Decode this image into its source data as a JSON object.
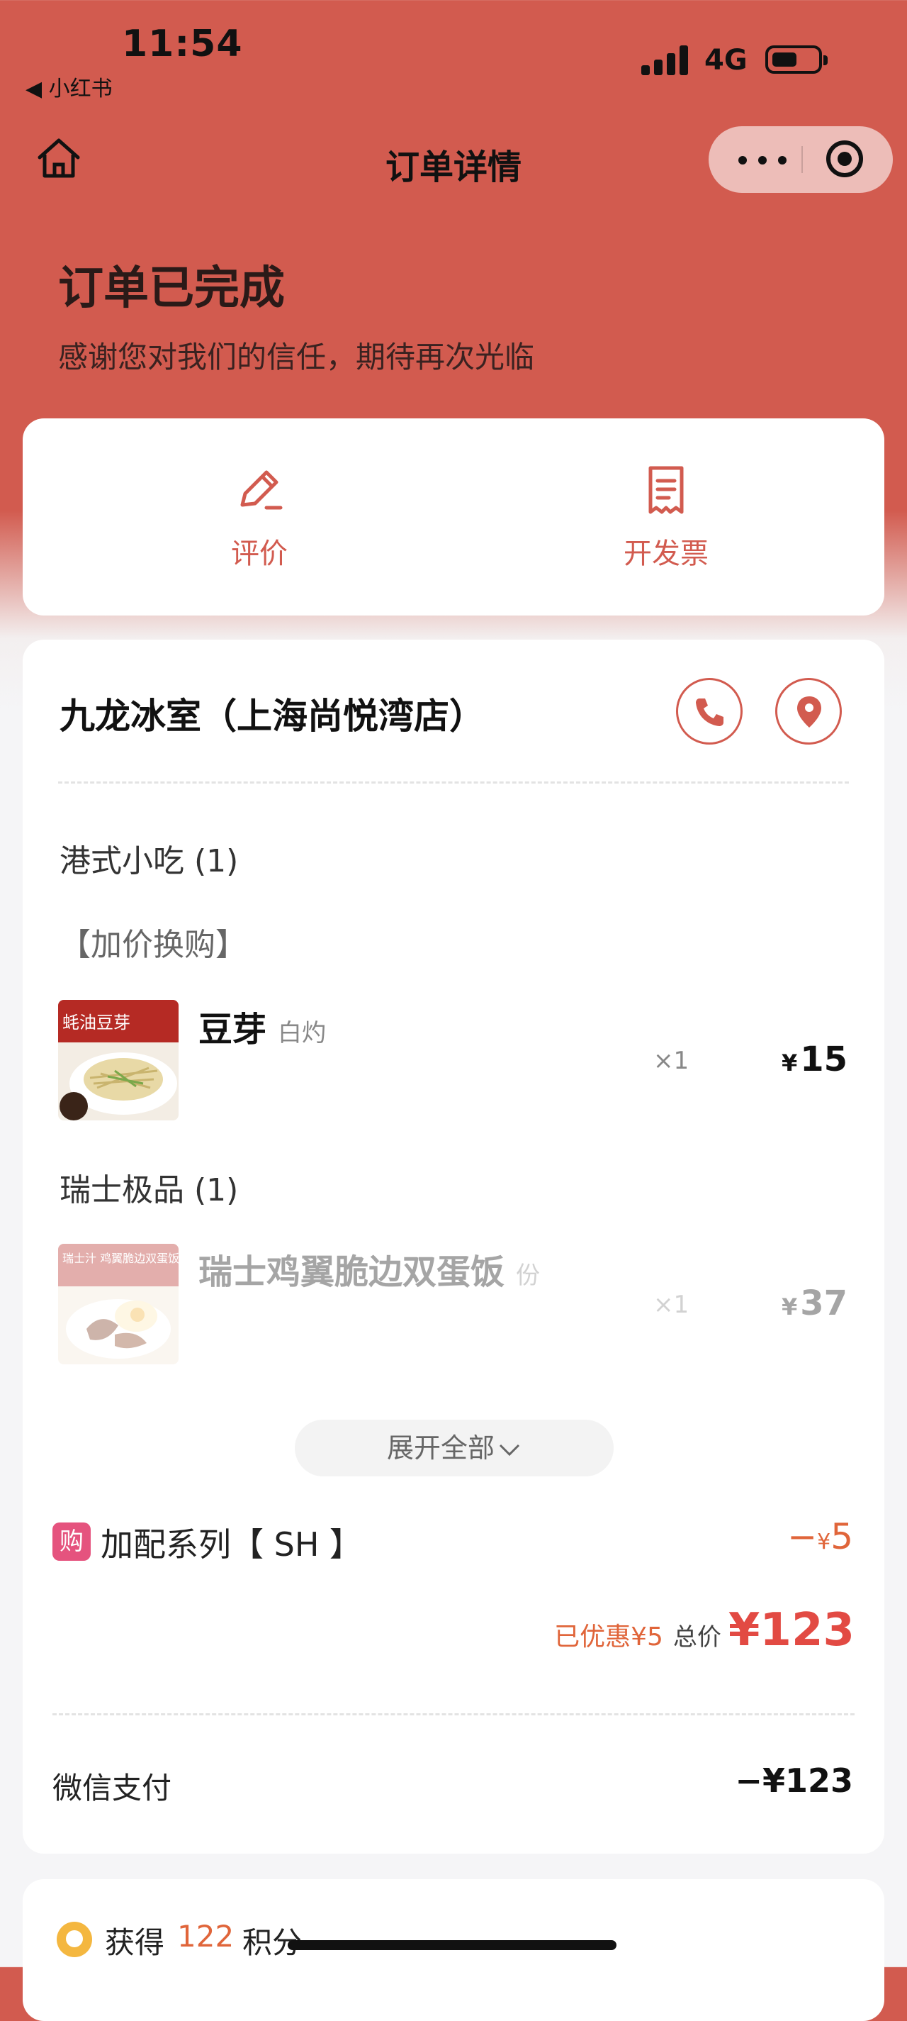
{
  "status_bar": {
    "time": "11:54",
    "back_app": "◀ 小红书",
    "network": "4G"
  },
  "nav": {
    "title": "订单详情"
  },
  "header": {
    "status_title": "订单已完成",
    "status_subtitle": "感谢您对我们的信任，期待再次光临"
  },
  "actions": [
    {
      "label": "评价",
      "icon": "pencil-icon"
    },
    {
      "label": "开发票",
      "icon": "receipt-icon"
    }
  ],
  "store": {
    "name": "九龙冰室（上海尚悦湾店）"
  },
  "categories": [
    {
      "name": "港式小吃 (1)",
      "sub": "【加价换购】",
      "items": [
        {
          "name": "豆芽",
          "spec": "白灼",
          "qty": "×1",
          "currency": "¥",
          "price": "15",
          "img_text": "蚝油豆芽"
        }
      ]
    },
    {
      "name": "瑞士极品 (1)",
      "items": [
        {
          "name": "瑞士鸡翼脆边双蛋饭",
          "spec": "份",
          "qty": "×1",
          "currency": "¥",
          "price": "37",
          "img_text": "瑞士汁 鸡翼脆边双蛋饭"
        }
      ]
    }
  ],
  "expand_label": "展开全部",
  "addon": {
    "badge": "购",
    "label": "加配系列【 SH 】",
    "discount_sign": "−",
    "currency": "¥",
    "discount": "5"
  },
  "summary": {
    "saved": "已优惠¥5",
    "total_label": "总价",
    "total": "¥123"
  },
  "payment": {
    "method": "微信支付",
    "amount": "−¥123"
  },
  "points": {
    "prefix": "获得",
    "value": "122",
    "suffix": "积分"
  },
  "colors": {
    "brand": "#d25b4f",
    "discount": "#e0653a",
    "total": "#e24a43",
    "addon_badge": "#e5537e"
  }
}
